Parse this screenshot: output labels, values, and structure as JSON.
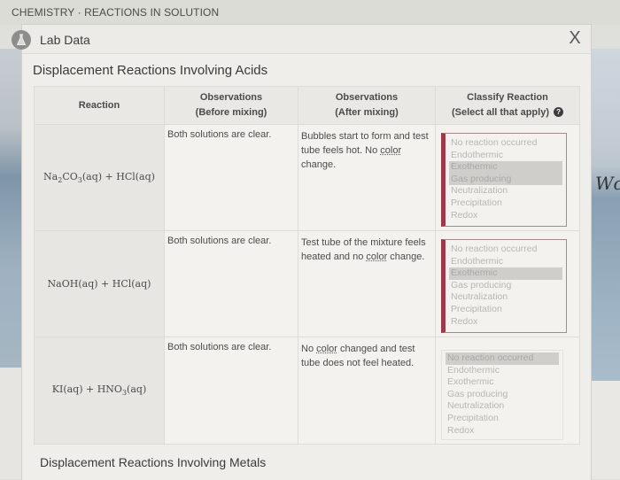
{
  "breadcrumb": "CHEMISTRY · REACTIONS IN SOLUTION",
  "panel": {
    "title": "Lab Data",
    "icon": "flask-icon",
    "close_label": "X"
  },
  "background": {
    "right_text": "Wc"
  },
  "section1": {
    "title": "Displacement Reactions Involving Acids",
    "columns": {
      "reaction": "Reaction",
      "before_line1": "Observations",
      "before_line2": "(Before mixing)",
      "after_line1": "Observations",
      "after_line2": "(After mixing)",
      "classify_line1": "Classify Reaction",
      "classify_line2": "(Select all that apply)"
    },
    "rows": [
      {
        "reaction_parts": [
          "Na",
          "2",
          "CO",
          "3",
          "(aq) + HCl(aq)"
        ],
        "before": "Both solutions are clear.",
        "after_pre": "Bubbles start to form and test tube feels hot. No ",
        "after_u": "color",
        "after_post": " change.",
        "options": [
          "No reaction occurred",
          "Endothermic",
          "Exothermic",
          "Gas producing",
          "Neutralization",
          "Precipitation",
          "Redox"
        ],
        "selected": [
          false,
          false,
          true,
          true,
          false,
          false,
          false
        ]
      },
      {
        "reaction_parts": [
          "NaOH(aq) + HCl(aq)"
        ],
        "before": "Both solutions are clear.",
        "after_pre": "Test tube of the mixture feels heated and no ",
        "after_u": "color",
        "after_post": " change.",
        "options": [
          "No reaction occurred",
          "Endothermic",
          "Exothermic",
          "Gas producing",
          "Neutralization",
          "Precipitation",
          "Redox"
        ],
        "selected": [
          false,
          false,
          true,
          false,
          false,
          false,
          false
        ]
      },
      {
        "reaction_parts": [
          "KI(aq) + HNO",
          "3",
          "(aq)"
        ],
        "before": "Both solutions are clear.",
        "after_pre": "No ",
        "after_u": "color",
        "after_post": " changed and test tube does not feel heated.",
        "options": [
          "No reaction occurred",
          "Endothermic",
          "Exothermic",
          "Gas producing",
          "Neutralization",
          "Precipitation",
          "Redox"
        ],
        "selected": [
          true,
          false,
          false,
          false,
          false,
          false,
          false
        ]
      }
    ]
  },
  "section2": {
    "title": "Displacement Reactions Involving Metals"
  }
}
